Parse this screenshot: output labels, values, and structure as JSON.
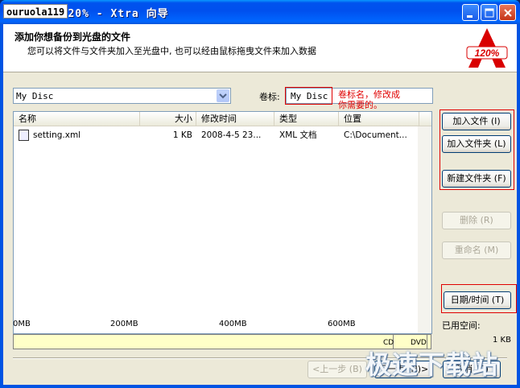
{
  "window": {
    "watermark_tag": "ouruola119",
    "title": "1 120% - Xtra 向导"
  },
  "header": {
    "title": "添加你想备份到光盘的文件",
    "subtitle": "您可以将文件与文件夹加入至光盘中, 也可以经由鼠标拖曳文件来加入数据",
    "logo_text": "120%"
  },
  "disc_combo": {
    "value": "My Disc"
  },
  "volume": {
    "label": "卷标:",
    "value": "My Disc",
    "annotation_line1": "卷标名，修改成",
    "annotation_line2": "你需要的。"
  },
  "file_list": {
    "columns": [
      "名称",
      "大小",
      "修改时间",
      "类型",
      "位置"
    ],
    "rows": [
      {
        "name": "setting.xml",
        "size": "1 KB",
        "modified": "2008-4-5 23...",
        "type": "XML 文档",
        "location": "C:\\Document..."
      }
    ]
  },
  "side_buttons": {
    "add_file": "加入文件 (I)",
    "add_folder": "加入文件夹 (L)",
    "new_folder": "新建文件夹 (F)",
    "delete": "删除 (R)",
    "rename": "重命名 (M)",
    "datetime": "日期/时间 (T)"
  },
  "space": {
    "used_label": "已用空间:",
    "used_value": "1 KB",
    "marks": [
      "0MB",
      "200MB",
      "400MB",
      "600MB"
    ],
    "cd_label": "CD",
    "dvd_label": "DVD"
  },
  "footer": {
    "back": "<上一步 (B)",
    "next": "下一步 (N)>",
    "cancel": "取消 (C)"
  },
  "site_watermark": "极速下载站",
  "colors": {
    "accent_red": "#e00000",
    "titlebar": "#0054e3",
    "dialog_bg": "#ece9d8"
  }
}
